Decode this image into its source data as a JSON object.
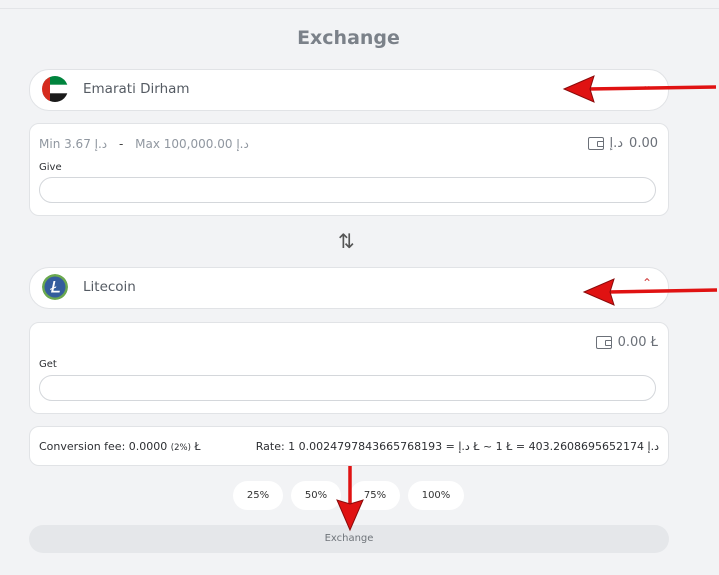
{
  "page": {
    "title": "Exchange"
  },
  "give_currency": {
    "name": "Emarati Dirham",
    "icon": "uae-flag-icon"
  },
  "give_panel": {
    "min_label": "Min 3.67",
    "max_label": "Max 100,000.00",
    "currency_symbol": "د.إ",
    "separator": "-",
    "balance": "0.00",
    "field_label": "Give",
    "value": ""
  },
  "swap_icon": "⇅",
  "get_currency": {
    "name": "Litecoin",
    "icon": "litecoin-icon"
  },
  "get_panel": {
    "balance": "0.00 Ł",
    "field_label": "Get",
    "value": ""
  },
  "info": {
    "fee_text": "Conversion fee: 0.0000",
    "fee_percent": "(2%)",
    "fee_unit": "Ł",
    "rate_text": "Rate: 1 د.إ = 0.0024797843665768193 Ł ~ 1 Ł = 403.2608695652174 د.إ"
  },
  "percent_buttons": [
    "25%",
    "50%",
    "75%",
    "100%"
  ],
  "exchange_button": "Exchange",
  "colors": {
    "annotation_arrow": "#e01212",
    "litecoin": "#345d9d"
  }
}
